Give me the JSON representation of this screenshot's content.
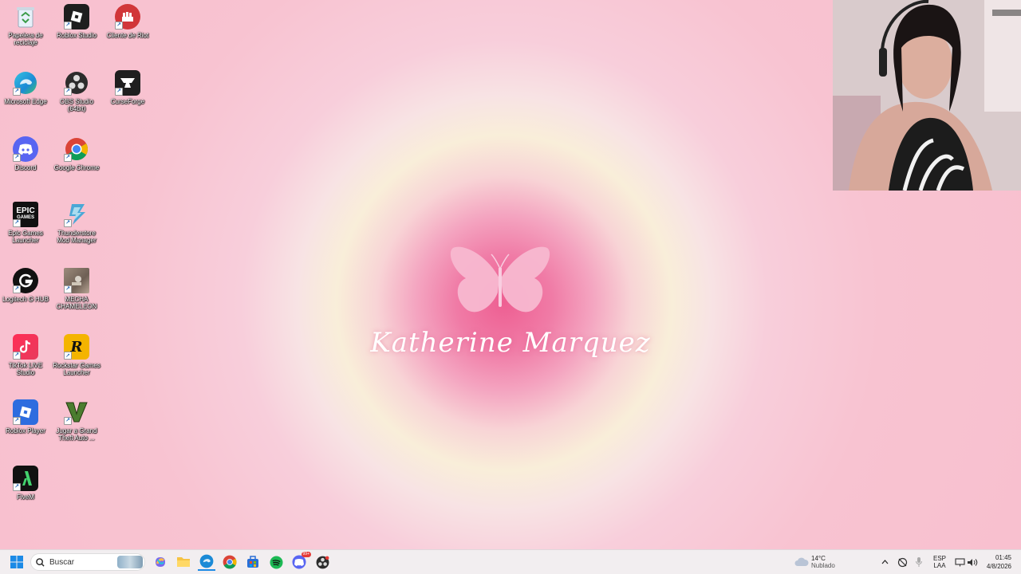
{
  "desktop": {
    "icons": [
      {
        "id": "recycle",
        "label": "Papelera de reciclaje",
        "color": "#ffffff"
      },
      {
        "id": "roblox-studio",
        "label": "Roblox Studio",
        "color": "#1e1e1e"
      },
      {
        "id": "riot",
        "label": "Cliente de Riot",
        "color": "#d13639"
      },
      {
        "id": "edge",
        "label": "Microsoft Edge",
        "color": "#1b8ad6"
      },
      {
        "id": "obs",
        "label": "OBS Studio (64bit)",
        "color": "#2c2c2c"
      },
      {
        "id": "curseforge",
        "label": "CurseForge",
        "color": "#1f1f1f"
      },
      {
        "id": "discord",
        "label": "Discord",
        "color": "#5865f2"
      },
      {
        "id": "chrome",
        "label": "Google Chrome",
        "color": "#ffffff"
      },
      {
        "id": "epic",
        "label": "Epic Games Launcher",
        "color": "#111111"
      },
      {
        "id": "thunderstore",
        "label": "Thunderstore Mod Manager",
        "color": "#4aa7d6"
      },
      {
        "id": "logitech",
        "label": "Logitech G HUB",
        "color": "#111111"
      },
      {
        "id": "chameleon",
        "label": "MECHA CHAMELEON",
        "color": "#8a7b6e"
      },
      {
        "id": "tiktok",
        "label": "TikTok LIVE Studio",
        "color": "#e83a5c"
      },
      {
        "id": "rockstar",
        "label": "Rockstar Games Launcher",
        "color": "#f4b400"
      },
      {
        "id": "roblox-player",
        "label": "Roblox Player",
        "color": "#2d6cdf"
      },
      {
        "id": "gta",
        "label": "Jugar a Grand Theft Auto ...",
        "color": "#ffffff"
      },
      {
        "id": "fivem",
        "label": "FiveM",
        "color": "#111111"
      }
    ]
  },
  "wallpaper": {
    "brand_name": "Katherine Marquez"
  },
  "taskbar": {
    "search_placeholder": "Buscar",
    "weather_temp": "14°C",
    "weather_desc": "Nublado",
    "lang_top": "ESP",
    "lang_bottom": "LAA",
    "time": "01:45",
    "date": "4/8/2026",
    "discord_badge": "99+"
  },
  "colors": {
    "accent": "#ee5f92",
    "taskbar": "#f2eef0"
  }
}
